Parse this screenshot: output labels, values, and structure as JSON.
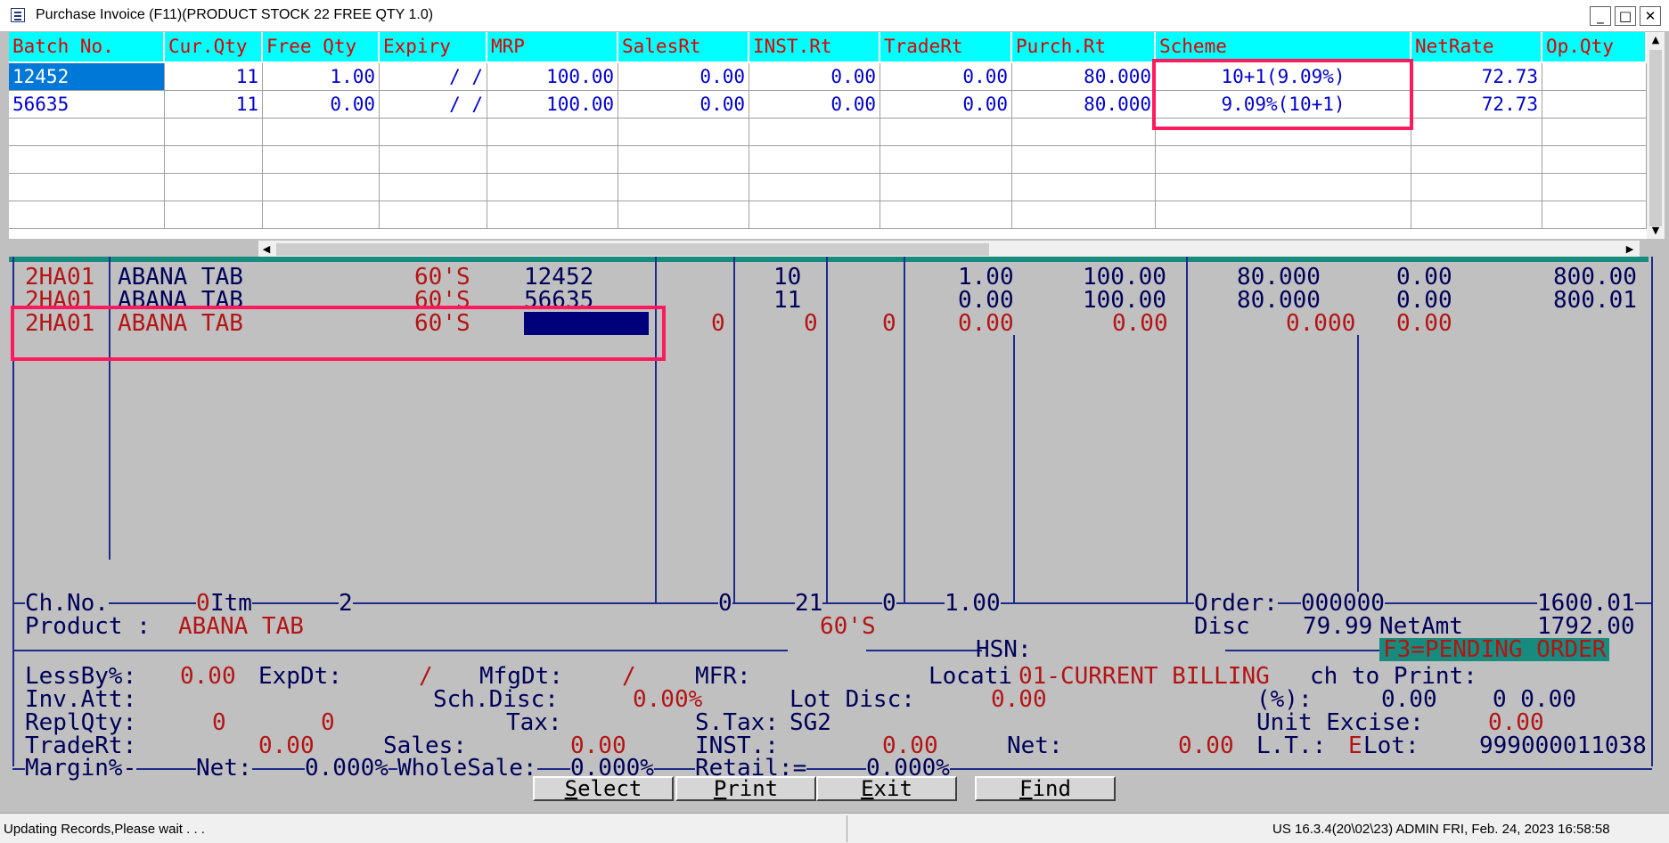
{
  "window": {
    "title": "Purchase Invoice  (F11)(PRODUCT STOCK 22 FREE QTY 1.0)",
    "minimize": "_",
    "maximize": "□",
    "close": "✕"
  },
  "batch_grid": {
    "columns": [
      "Batch No.",
      "Cur.Qty",
      "Free Qty",
      "Expiry",
      "MRP",
      "SalesRt",
      "INST.Rt",
      "TradeRt",
      "Purch.Rt",
      "Scheme",
      "NetRate",
      "Op.Qty"
    ],
    "rows": [
      {
        "batch": "12452",
        "cur_qty": "11",
        "free_qty": "1.00",
        "expiry": "/  /",
        "mrp": "100.00",
        "sales_rt": "0.00",
        "inst_rt": "0.00",
        "trade_rt": "0.00",
        "purch_rt": "80.000",
        "scheme": "10+1(9.09%)",
        "net_rate": "72.73",
        "op_qty": ""
      },
      {
        "batch": "56635",
        "cur_qty": "11",
        "free_qty": "0.00",
        "expiry": "/  /",
        "mrp": "100.00",
        "sales_rt": "0.00",
        "inst_rt": "0.00",
        "trade_rt": "0.00",
        "purch_rt": "80.000",
        "scheme": "9.09%(10+1)",
        "net_rate": "72.73",
        "op_qty": ""
      }
    ],
    "scroll_up": "▲",
    "scroll_down": "▼",
    "scroll_left": "◀",
    "scroll_right": "▶"
  },
  "items": [
    {
      "code": "2HA01",
      "name": "ABANA TAB",
      "pack": "60'S",
      "batch": "12452",
      "c1": "",
      "c2": "10",
      "c3": "",
      "c4": "1.00",
      "c5": "100.00",
      "c6": "80.000",
      "c7": "0.00",
      "c8": "800.00"
    },
    {
      "code": "2HA01",
      "name": "ABANA TAB",
      "pack": "60'S",
      "batch": "56635",
      "c1": "",
      "c2": "11",
      "c3": "",
      "c4": "0.00",
      "c5": "100.00",
      "c6": "80.000",
      "c7": "0.00",
      "c8": "800.01"
    },
    {
      "code": "2HA01",
      "name": "ABANA TAB",
      "pack": "60'S",
      "batch": "",
      "c1": "0",
      "c2": "0",
      "c3": "0",
      "c4": "0.00",
      "c5": "0.00",
      "c6": "0.000",
      "c7": "0.00",
      "c8": ""
    }
  ],
  "totals": {
    "chno_label": "Ch.No.",
    "chno_value": "0",
    "itm_label": "Itm",
    "itm_value": "2",
    "t1": "0",
    "t2": "21",
    "t3": "0",
    "t4": "1.00",
    "order_label": "Order:",
    "order_value": "000000",
    "order_total": "1600.01"
  },
  "product": {
    "label": "Product :",
    "name": "ABANA TAB",
    "pack": "60'S",
    "disc_label": "Disc",
    "disc_value": "79.99",
    "netamt_label": "NetAmt",
    "netamt_value": "1792.00",
    "hsn_label": "HSN:",
    "pending_order": "F3=PENDING ORDER"
  },
  "details": {
    "lessby_label": "LessBy%:",
    "lessby_value": "0.00",
    "expdt_label": "ExpDt:",
    "expdt_value": "/",
    "mfgdt_label": "MfgDt:",
    "mfgdt_value": "/",
    "mfr_label": "MFR:",
    "locati_label": "Locati",
    "locati_value": "01-CURRENT BILLING",
    "chtoprint_label": "ch to Print:",
    "invatt_label": "Inv.Att:",
    "schdisc_label": "Sch.Disc:",
    "schdisc_value": "0.00%",
    "lotdisc_label": "Lot Disc:",
    "lotdisc_value": "0.00",
    "pct_label": "(%):",
    "pct_value": "0.00",
    "pct_value2": "0 0.00",
    "replqty_label": "ReplQty:",
    "replqty_v1": "0",
    "replqty_v2": "0",
    "tax_label": "Tax:",
    "stax_label": "S.Tax:",
    "stax_value": "SG2",
    "unitexcise_label": "Unit Excise:",
    "unitexcise_value": "0.00",
    "tradert_label": "TradeRt:",
    "tradert_value": "0.00",
    "sales_label": "Sales:",
    "sales_value": "0.00",
    "inst_label": "INST.:",
    "inst_value": "0.00",
    "net_label": "Net:",
    "net_value": "0.00",
    "lt_label": "L.T.:",
    "lt_value": "E",
    "lot_label": "Lot:",
    "lot_value": "999000011038",
    "margin_label": "Margin%-",
    "mnet_label": "Net:",
    "mnet_value": "0.000%",
    "wholesale_label": "WholeSale:",
    "wholesale_value": "0.000%",
    "retail_label": "Retail:=",
    "retail_value": "0.000%"
  },
  "buttons": {
    "select_key": "S",
    "select_rest": "elect",
    "print_key": "P",
    "print_rest": "rint",
    "exit_key": "E",
    "exit_rest": "xit",
    "find_key": "F",
    "find_rest": "ind"
  },
  "status": {
    "message": "Updating Records,Please wait . . .",
    "info": "US 16.3.4(20\\02\\23) ADMIN  FRI, Feb. 24, 2023  16:58:58"
  },
  "colors": {
    "grid_header_bg": "#00ffff",
    "grid_header_text": "#e00000",
    "grid_text": "#0000cc",
    "selection": "#0078d7",
    "dos_bg": "#c0c0c0",
    "dos_red": "#b41414",
    "dos_blue": "#00005a",
    "highlight_box": "#ff1a5e",
    "pending_bg": "#178b7e"
  }
}
